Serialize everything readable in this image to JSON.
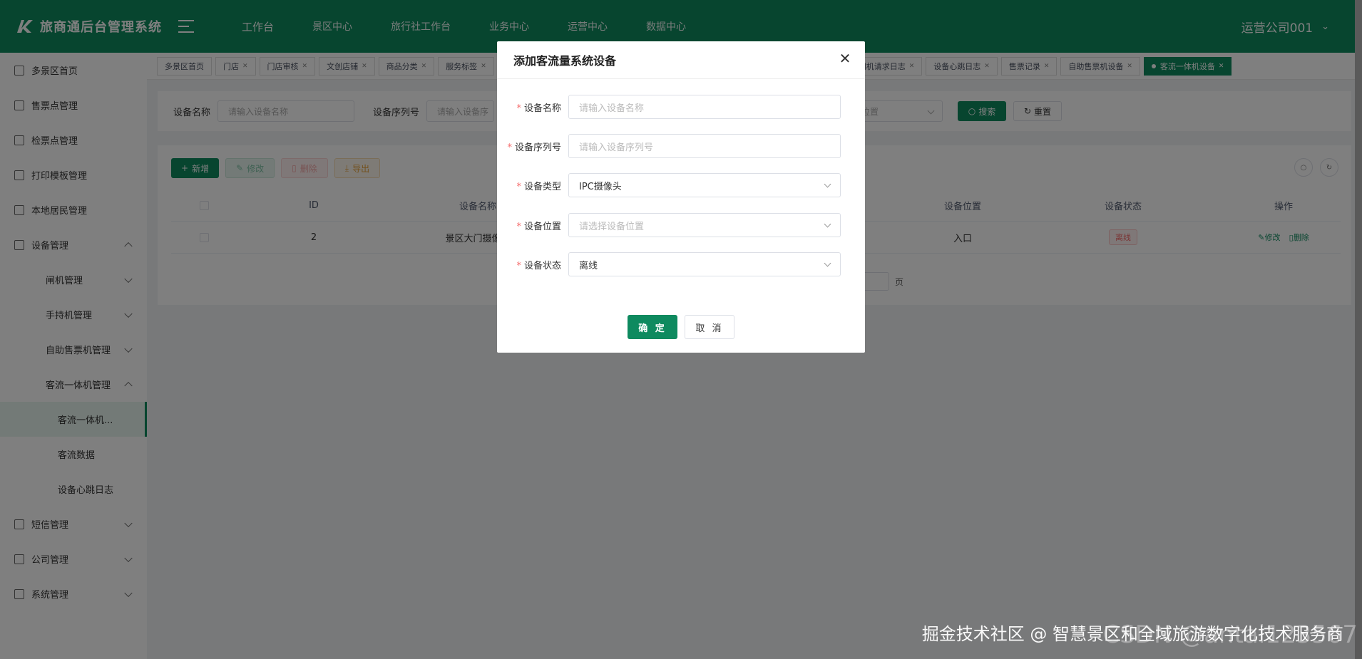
{
  "header": {
    "app_title": "旅商通后台管理系统",
    "nav": [
      "工作台",
      "景区中心",
      "旅行社工作台",
      "业务中心",
      "运营中心",
      "数据中心"
    ],
    "user": "运营公司001"
  },
  "sidebar": {
    "items": [
      {
        "label": "多景区首页"
      },
      {
        "label": "售票点管理"
      },
      {
        "label": "检票点管理"
      },
      {
        "label": "打印模板管理"
      },
      {
        "label": "本地居民管理"
      },
      {
        "label": "设备管理"
      },
      {
        "label": "闸机管理"
      },
      {
        "label": "手持机管理"
      },
      {
        "label": "自助售票机管理"
      },
      {
        "label": "客流一体机管理"
      },
      {
        "label": "客流一体机..."
      },
      {
        "label": "客流数据"
      },
      {
        "label": "设备心跳日志"
      },
      {
        "label": "短信管理"
      },
      {
        "label": "公司管理"
      },
      {
        "label": "系统管理"
      }
    ]
  },
  "tabs": [
    "多景区首页",
    "门店",
    "门店审核",
    "文创店铺",
    "商品分类",
    "服务标签",
    "闸机请求日志",
    "设备心跳日志",
    "售票记录",
    "自助售票机设备",
    "客流一体机设备"
  ],
  "search": {
    "name_label": "设备名称",
    "name_placeholder": "请输入设备名称",
    "serial_label": "设备序列号",
    "serial_placeholder": "请输入设备序",
    "location_placeholder": "位置",
    "search_btn": "搜索",
    "reset_btn": "重置"
  },
  "toolbar": {
    "add": "新增",
    "edit": "修改",
    "delete": "删除",
    "export": "导出"
  },
  "table": {
    "headers": {
      "id": "ID",
      "name": "设备名称",
      "location": "设备位置",
      "status": "设备状态",
      "ops": "操作"
    },
    "row": {
      "id": "2",
      "name": "景区大门摄像头",
      "location": "入口",
      "status": "离线",
      "edit": "修改",
      "delete": "删除"
    },
    "pager_suffix": "页"
  },
  "dialog": {
    "title": "添加客流量系统设备",
    "fields": {
      "name_label": "设备名称",
      "name_placeholder": "请输入设备名称",
      "serial_label": "设备序列号",
      "serial_placeholder": "请输入设备序列号",
      "type_label": "设备类型",
      "type_value": "IPC摄像头",
      "location_label": "设备位置",
      "location_placeholder": "请选择设备位置",
      "status_label": "设备状态",
      "status_value": "离线"
    },
    "ok": "确 定",
    "cancel": "取 消"
  },
  "watermark": {
    "text": "掘金技术社区 @ 智慧景区和全域旅游数字化技术服务商",
    "bg": "CSDN @antai123567"
  },
  "colors": {
    "brand": "#0e8a5f",
    "danger": "#f56c6c"
  }
}
